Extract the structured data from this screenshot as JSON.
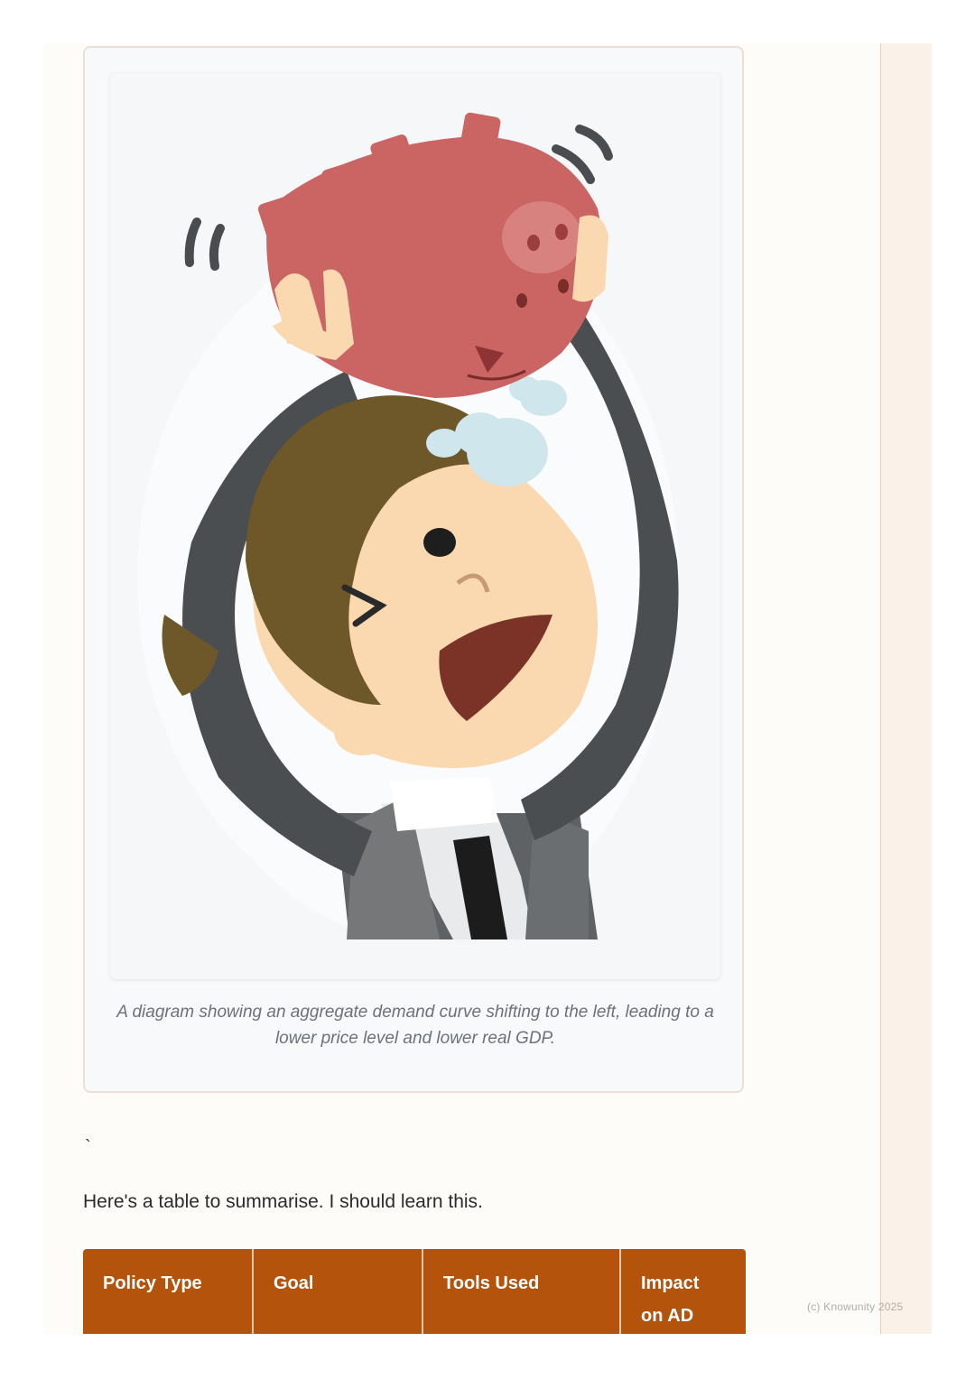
{
  "figure": {
    "image_alt": "Cartoon of a man in a grey suit shaking an empty pink piggy bank above his head",
    "caption": "A diagram showing an aggregate demand curve shifting to the left, leading to a lower price level and lower real GDP."
  },
  "body": {
    "stray_mark": "`",
    "intro": "Here's a table to summarise. I should learn this."
  },
  "table": {
    "headers": [
      "Policy Type",
      "Goal",
      "Tools Used",
      "Impact on AD"
    ]
  },
  "footer": {
    "watermark": "(c) Knowunity 2025"
  }
}
